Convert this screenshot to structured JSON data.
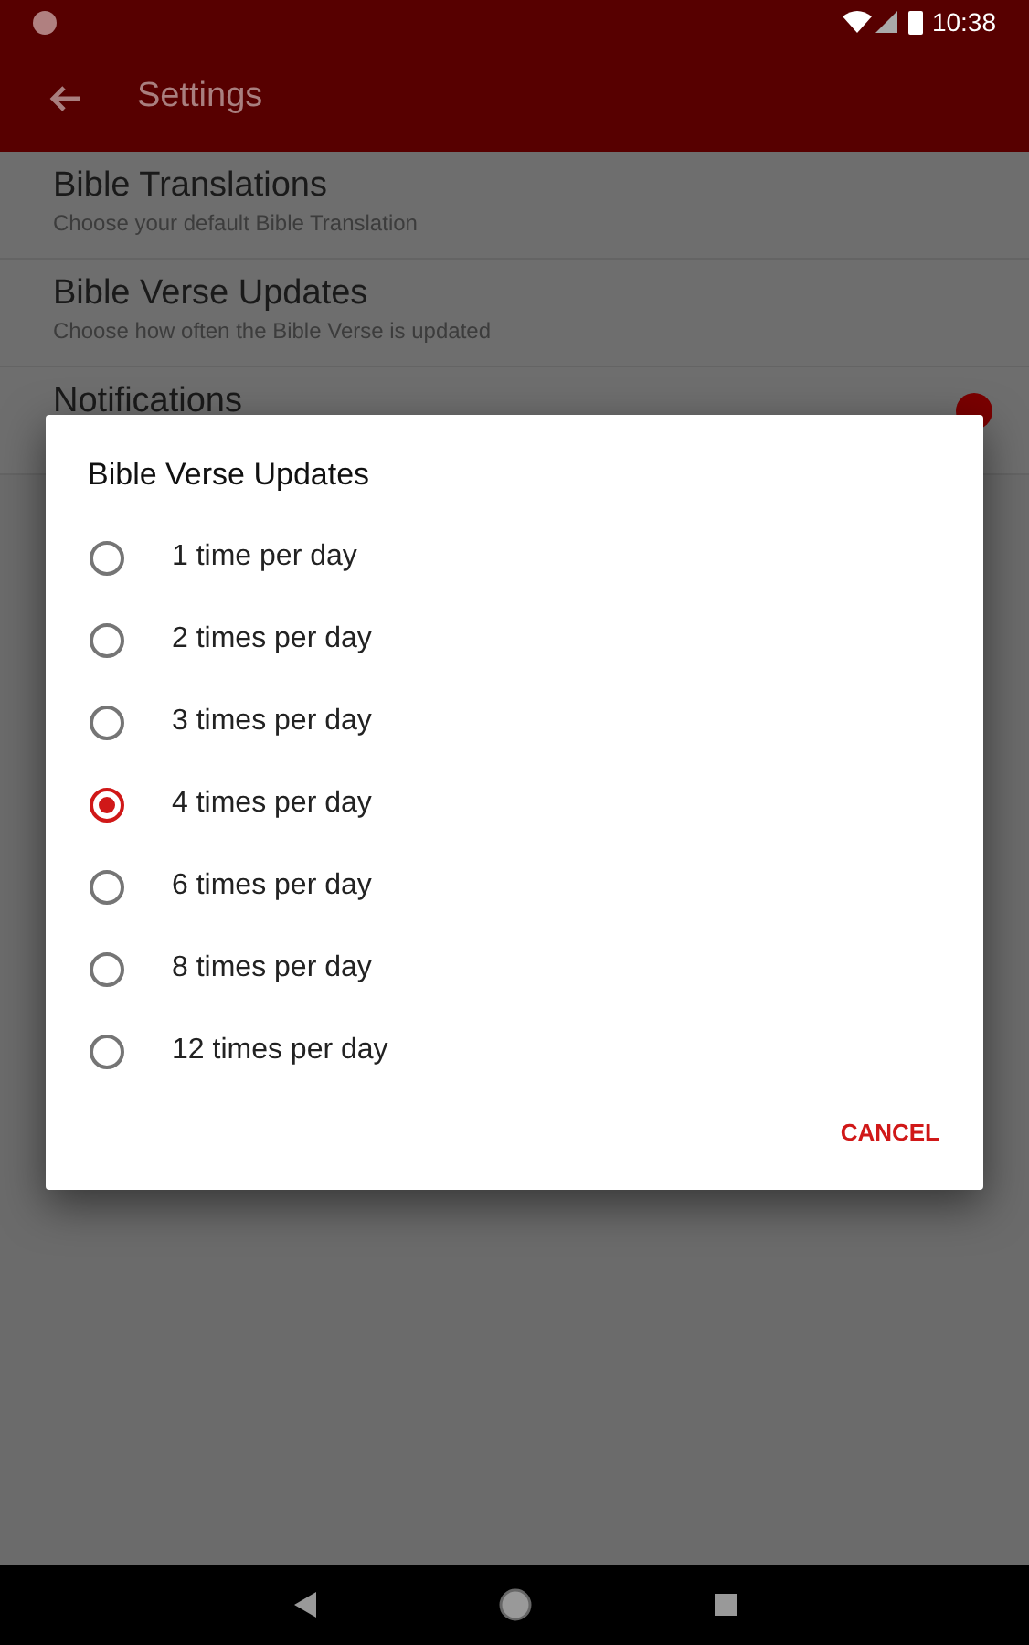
{
  "status_bar": {
    "time": "10:38"
  },
  "app_bar": {
    "title": "Settings"
  },
  "settings": [
    {
      "title": "Bible Translations",
      "subtitle": "Choose your default Bible Translation"
    },
    {
      "title": "Bible Verse Updates",
      "subtitle": "Choose how often the Bible Verse is updated"
    },
    {
      "title": "Notifications",
      "on": true
    }
  ],
  "dialog": {
    "title": "Bible Verse Updates",
    "options": [
      {
        "label": "1 time per day",
        "selected": false
      },
      {
        "label": "2 times per day",
        "selected": false
      },
      {
        "label": "3 times per day",
        "selected": false
      },
      {
        "label": "4 times per day",
        "selected": true
      },
      {
        "label": "6 times per day",
        "selected": false
      },
      {
        "label": "8 times per day",
        "selected": false
      },
      {
        "label": "12 times per day",
        "selected": false
      }
    ],
    "button": "CANCEL"
  }
}
